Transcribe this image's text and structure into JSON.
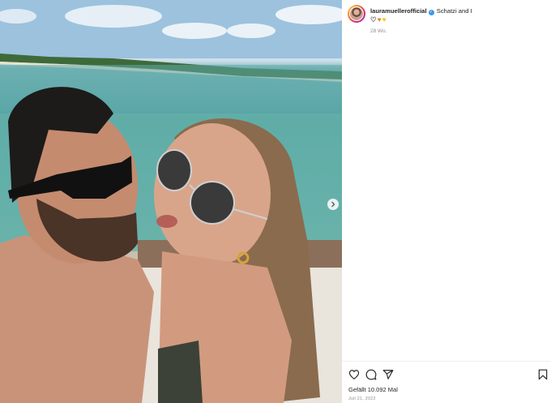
{
  "post": {
    "username": "lauramuellerofficial",
    "verified_badge": "✓",
    "caption": "Schatzi and I",
    "caption_emojis": [
      "♡",
      "♥",
      "♥"
    ],
    "age": "28 Wo.",
    "likes_text": "Gefällt 10.092 Mal",
    "date": "Juli 21, 2022"
  },
  "icons": {
    "like": "heart-outline-icon",
    "comment": "comment-bubble-icon",
    "share": "paper-plane-icon",
    "save": "bookmark-icon",
    "next": "chevron-right-icon"
  },
  "colors": {
    "verified": "#3897f0",
    "heart_orange": "#f0812e",
    "heart_yellow": "#f6c417",
    "muted_text": "#8e8e8e"
  }
}
